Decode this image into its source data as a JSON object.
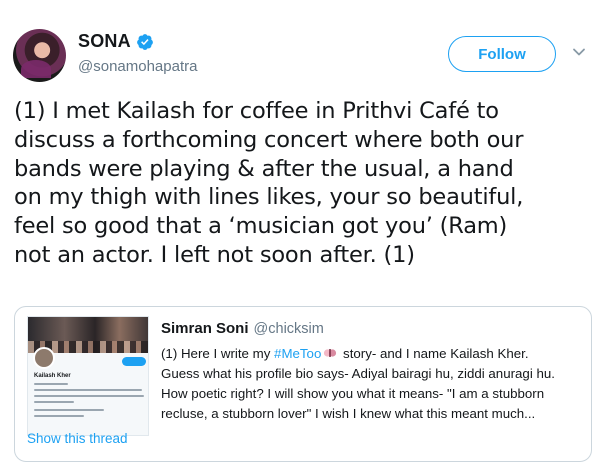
{
  "tweet": {
    "author": {
      "display_name": "SONA",
      "handle": "@sonamohapatra",
      "verified": true
    },
    "follow_label": "Follow",
    "text_lines": [
      "(1) I met Kailash for coffee in Prithvi Café to",
      "discuss a forthcoming concert where both our",
      "bands were playing & after the usual, a hand",
      "on my thigh with lines likes, your so beautiful,",
      "feel so good that a ‘musician got you’ (Ram)",
      "not an actor. I left not soon after. (1)"
    ]
  },
  "quoted_tweet": {
    "author_name": "Simran Soni",
    "author_handle": "@chicksim",
    "thumb_profile_name": "Kailash Kher",
    "body_lines": [
      {
        "pre": "(1) Here I write my ",
        "hashtag": "#MeToo",
        "post": " story- and I name Kailash Kher."
      },
      {
        "text": "Guess what his profile bio says- Adiyal bairagi hu, ziddi anuragi hu."
      },
      {
        "text": "How poetic right? I will show you what it means- \"I am a stubborn"
      },
      {
        "text": "recluse, a stubborn lover\" I wish I knew what this meant much..."
      }
    ],
    "show_thread_label": "Show this thread"
  },
  "colors": {
    "link": "#1da1f2",
    "text": "#14171a",
    "secondary": "#657786",
    "border": "#ccd6dd"
  },
  "icons": [
    "verified-badge-icon",
    "chevron-down-icon",
    "emoji-icon"
  ]
}
